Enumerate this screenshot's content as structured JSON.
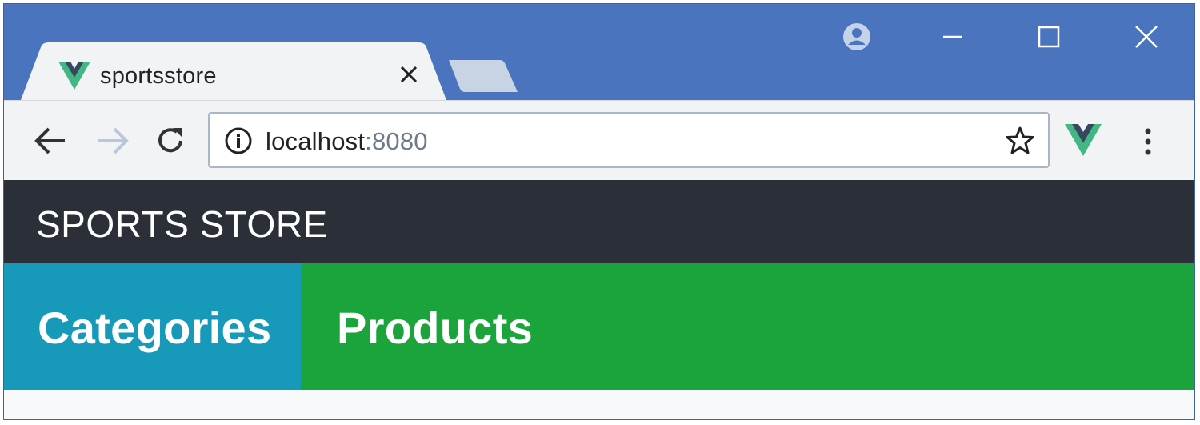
{
  "browser": {
    "tab": {
      "title": "sportsstore",
      "favicon": "vue-logo-icon",
      "close_icon": "close-icon"
    },
    "new_tab_icon": "new-tab-icon",
    "window_controls": [
      "profile-icon",
      "minimize-icon",
      "maximize-icon",
      "close-icon"
    ],
    "address_bar": {
      "host": "localhost",
      "port": ":8080"
    },
    "nav_icons": [
      "back-icon",
      "forward-icon",
      "reload-icon"
    ],
    "colors": {
      "frame": "#4a74bd",
      "toolbar": "#f2f3f5",
      "vue_green": "#41b883",
      "vue_dark": "#35495e"
    }
  },
  "page": {
    "brand": "SPORTS STORE",
    "categories_heading": "Categories",
    "products_heading": "Products",
    "colors": {
      "navbar": "#2b2f38",
      "categories_bg": "#1799b9",
      "products_bg": "#1ba43b"
    }
  }
}
